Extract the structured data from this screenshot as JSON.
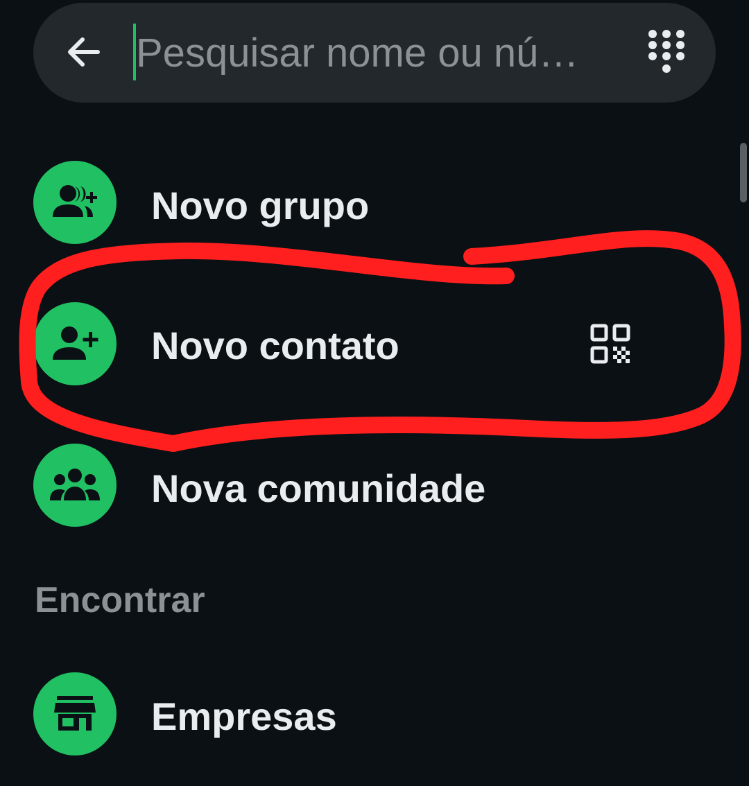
{
  "search": {
    "placeholder": "Pesquisar nome ou nú…",
    "value": "",
    "back_icon": "arrow-left-icon",
    "dialpad_icon": "dialpad-icon"
  },
  "menu": {
    "items": [
      {
        "label": "Novo grupo",
        "icon": "group-add-icon"
      },
      {
        "label": "Novo contato",
        "icon": "person-add-icon",
        "trailing_icon": "qr-code-icon"
      },
      {
        "label": "Nova comunidade",
        "icon": "community-icon"
      }
    ]
  },
  "find_section": {
    "header": "Encontrar",
    "items": [
      {
        "label": "Empresas",
        "icon": "storefront-icon"
      }
    ]
  },
  "colors": {
    "background": "#0b1014",
    "search_bar": "#23282c",
    "accent_green": "#21c063",
    "text_primary": "#e9edef",
    "text_secondary": "#8b9195",
    "annotation_red": "#ff1f1f"
  }
}
